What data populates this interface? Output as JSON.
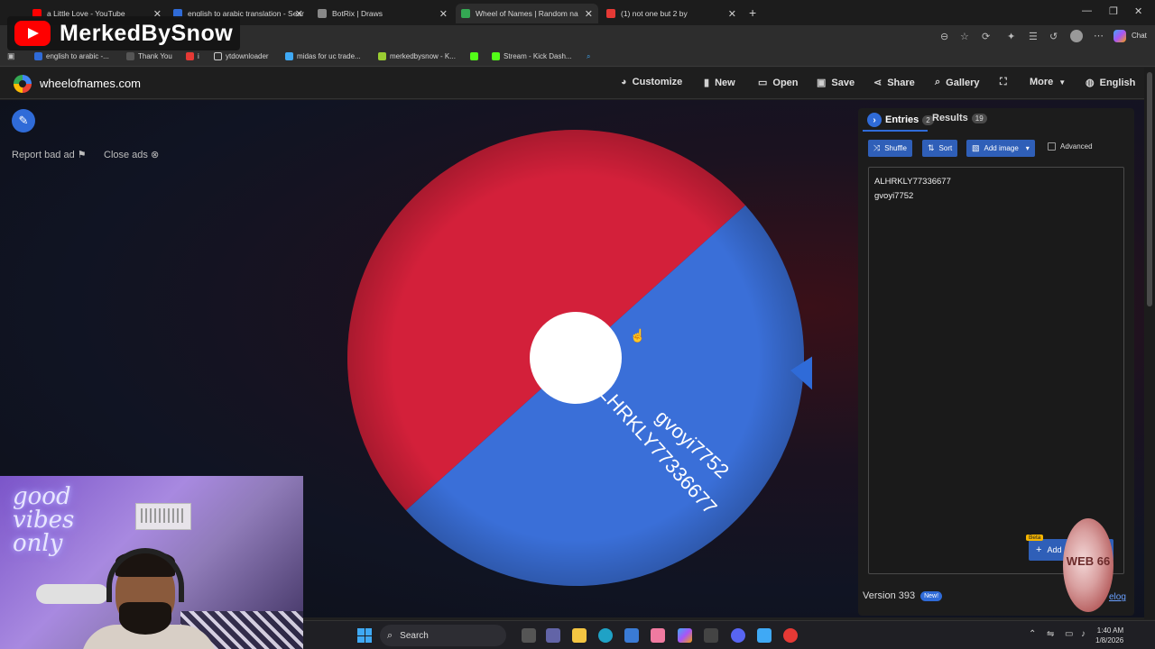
{
  "overlay": {
    "channel_name": "MerkedBySnow"
  },
  "browser": {
    "tabs": [
      {
        "label": "a Little Love - YouTube",
        "color": "#ff0000"
      },
      {
        "label": "english to arabic translation - Sear",
        "color": "#2f6bd8"
      },
      {
        "label": "BotRix | Draws",
        "color": "#888888"
      },
      {
        "label": "Wheel of Names | Random na",
        "color": "#34a853"
      },
      {
        "label": "(1) not one but 2 by",
        "color": "#e53935"
      }
    ],
    "new_tab": "+",
    "window_controls": [
      "—",
      "❐",
      "✕"
    ],
    "chat_label": "Chat",
    "bookmarks": [
      {
        "label": "english to arabic -...",
        "color": "#2f6bd8"
      },
      {
        "label": "Thank You",
        "color": "#555555"
      },
      {
        "label": "i",
        "color": "#e53935"
      },
      {
        "label": "ytdownloader",
        "color": "#777777"
      },
      {
        "label": "midas for uc trade...",
        "color": "#3fa9f5"
      },
      {
        "label": "merkedbysnow - K...",
        "color": "#9acd32"
      },
      {
        "label": "",
        "color": "#53fc18"
      },
      {
        "label": "Stream - Kick Dash...",
        "color": "#53fc18"
      }
    ]
  },
  "app": {
    "site_title": "wheelofnames.com",
    "nav": {
      "customize": "Customize",
      "new": "New",
      "open": "Open",
      "save": "Save",
      "share": "Share",
      "gallery": "Gallery",
      "more": "More",
      "language": "English"
    },
    "ads": {
      "report": "Report bad ad",
      "close": "Close ads"
    },
    "wheel": {
      "segments": [
        {
          "label": "gvoyi7752",
          "color": "#d3203a"
        },
        {
          "label": "ALHRKLY77336677",
          "color": "#3a6fd8"
        }
      ],
      "pointer_color": "#2f6bd8"
    },
    "panel": {
      "tab_entries": "Entries",
      "entries_count": "2",
      "tab_results": "Results",
      "results_count": "19",
      "shuffle": "Shuffle",
      "sort": "Sort",
      "add_image": "Add image",
      "advanced": "Advanced",
      "entries": [
        "ALHRKLY77336677",
        "gvoyi7752"
      ],
      "add_button": "Add",
      "beta": "Beta",
      "version": "Version 393",
      "new_badge": "New!",
      "changelog": "elog"
    }
  },
  "webcam": {
    "neon_text": "good vibes only"
  },
  "chip": {
    "text": "WEB 66"
  },
  "taskbar": {
    "search": "Search",
    "time": "1:40 AM",
    "date": "1/8/2026"
  }
}
